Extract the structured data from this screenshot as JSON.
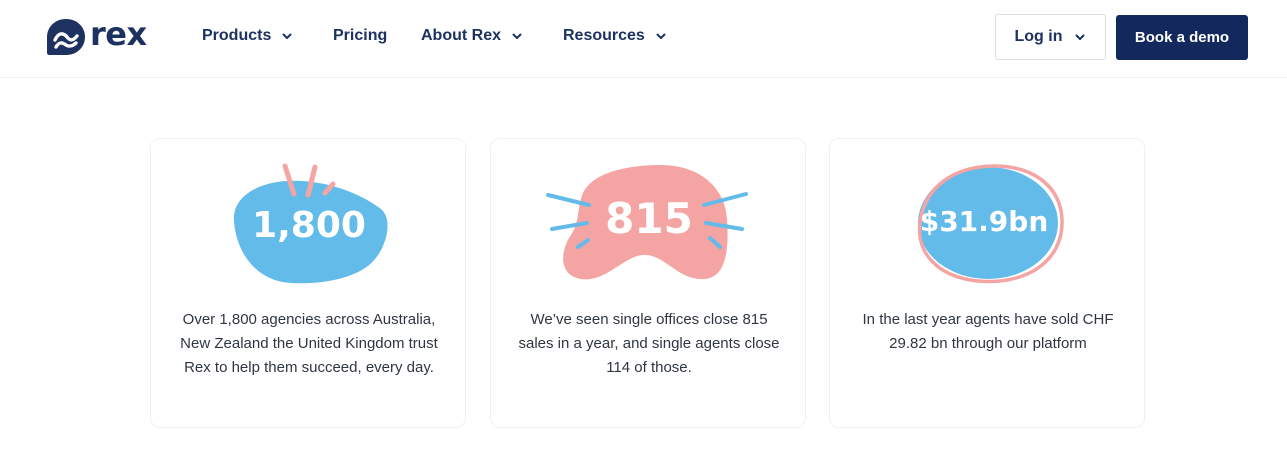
{
  "brand": {
    "name": "rex",
    "colors": {
      "navy": "#13295e",
      "blue": "#63bbe9",
      "pink": "#f4a5a3"
    }
  },
  "nav": {
    "items": [
      {
        "label": "Products",
        "has_dropdown": true
      },
      {
        "label": "Pricing",
        "has_dropdown": false
      },
      {
        "label": "About Rex",
        "has_dropdown": true
      },
      {
        "label": "Resources",
        "has_dropdown": true
      }
    ],
    "login_label": "Log in",
    "demo_label": "Book a demo"
  },
  "stats": [
    {
      "value": "1,800",
      "description": "Over 1,800 agencies across Australia, New Zealand the United Kingdom trust Rex to help them succeed, every day."
    },
    {
      "value": "815",
      "description": "We’ve seen single offices close 815 sales in a year, and single agents close 114 of those."
    },
    {
      "value": "$31.9bn",
      "description": "In the last year agents have sold CHF 29.82 bn through our platform"
    }
  ]
}
